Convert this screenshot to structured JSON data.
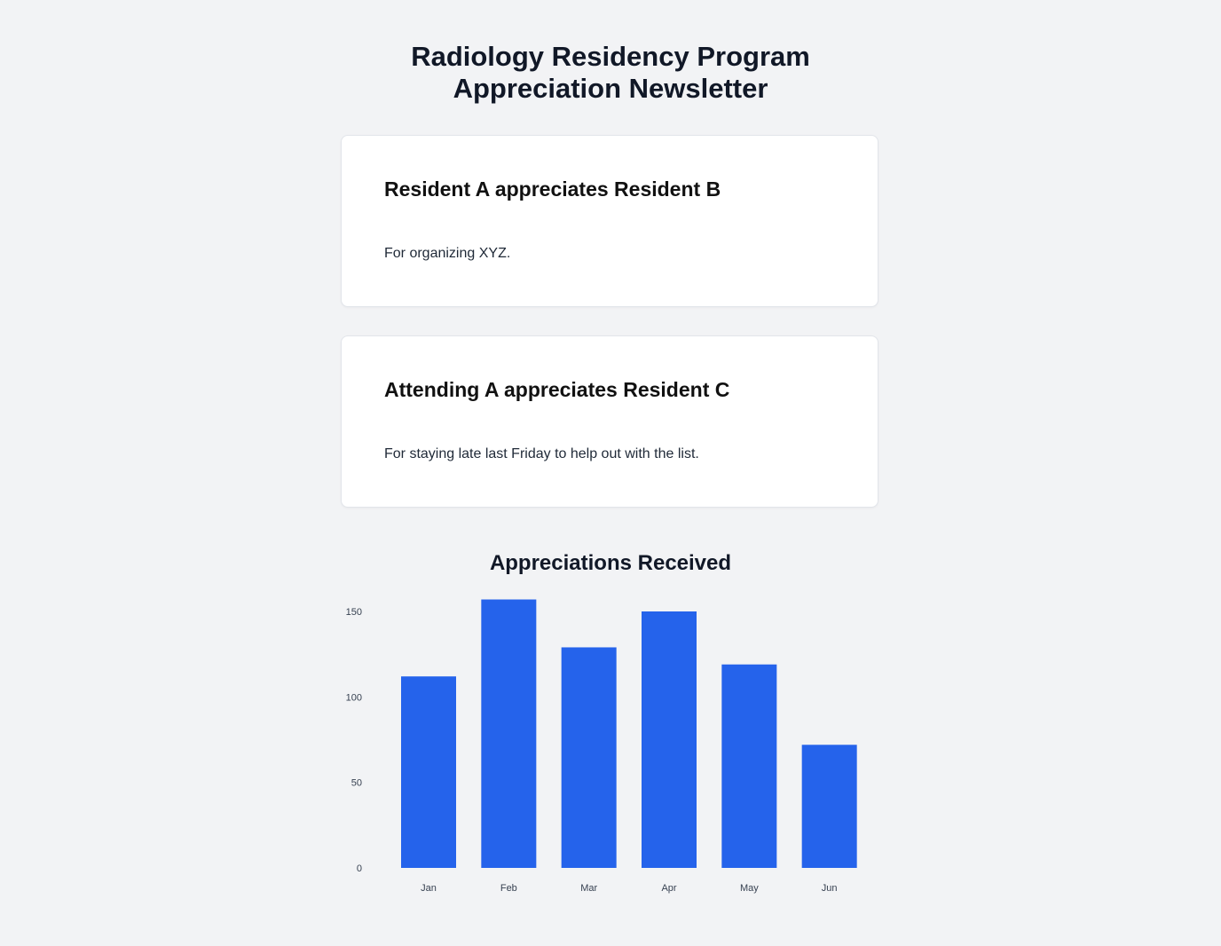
{
  "header": {
    "title_line1": "Radiology Residency Program",
    "title_line2": "Appreciation Newsletter"
  },
  "appreciations": [
    {
      "heading": "Resident A appreciates Resident B",
      "message": "For organizing XYZ."
    },
    {
      "heading": "Attending A appreciates Resident C",
      "message": "For staying late last Friday to help out with the list."
    }
  ],
  "chart_data": {
    "type": "bar",
    "title": "Appreciations Received",
    "categories": [
      "Jan",
      "Feb",
      "Mar",
      "Apr",
      "May",
      "Jun"
    ],
    "values": [
      112,
      157,
      129,
      150,
      119,
      72
    ],
    "ylim": [
      0,
      150
    ],
    "yticks": [
      0,
      50,
      100,
      150
    ],
    "xlabel": "",
    "ylabel": "",
    "grid": false,
    "legend": "none",
    "bar_color": "#2563eb"
  }
}
